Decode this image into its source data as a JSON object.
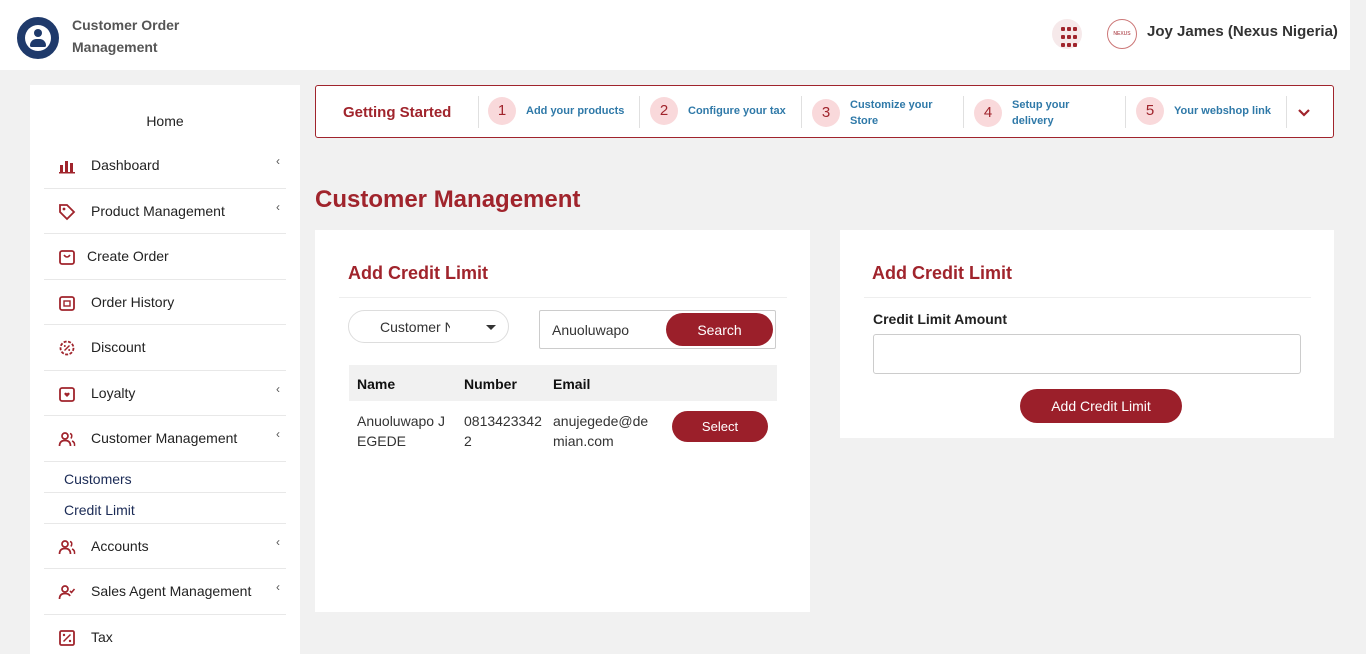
{
  "header": {
    "app_name": "Customer Order Management",
    "user_name": "Joy James (Nexus Nigeria)",
    "avatar_text": "NEXUS"
  },
  "sidebar": {
    "home": "Home",
    "items": [
      {
        "label": "Dashboard",
        "icon": "bar-chart-icon",
        "has_chevron": true
      },
      {
        "label": "Product Management",
        "icon": "tag-icon",
        "has_chevron": true
      },
      {
        "label": "Create Order",
        "icon": "shopping-bag-icon",
        "has_chevron": false
      },
      {
        "label": "Order History",
        "icon": "order-history-icon",
        "has_chevron": false
      },
      {
        "label": "Discount",
        "icon": "discount-badge-icon",
        "has_chevron": false
      },
      {
        "label": "Loyalty",
        "icon": "loyalty-bag-icon",
        "has_chevron": true
      },
      {
        "label": "Customer Management",
        "icon": "users-icon",
        "has_chevron": true
      },
      {
        "label": "Accounts",
        "icon": "users-icon",
        "has_chevron": true
      },
      {
        "label": "Sales Agent Management",
        "icon": "user-check-icon",
        "has_chevron": true
      },
      {
        "label": "Tax",
        "icon": "percent-icon",
        "has_chevron": false
      }
    ],
    "customer_sub_items": [
      "Customers",
      "Credit Limit"
    ]
  },
  "getting_started": {
    "title": "Getting Started",
    "steps": [
      {
        "num": "1",
        "label": "Add your products"
      },
      {
        "num": "2",
        "label": "Configure your tax"
      },
      {
        "num": "3",
        "label": "Customize your Store"
      },
      {
        "num": "4",
        "label": "Setup your delivery"
      },
      {
        "num": "5",
        "label": "Your webshop link"
      }
    ]
  },
  "page": {
    "title": "Customer Management"
  },
  "left_card": {
    "title": "Add Credit Limit",
    "select_value": "Customer Name",
    "search_value": "Anuoluwapo",
    "search_button": "Search",
    "columns": [
      "Name",
      "Number",
      "Email"
    ],
    "rows": [
      {
        "name": "Anuoluwapo JEGEDE",
        "number": "08134233422",
        "email": "anujegede@demian.com",
        "action": "Select"
      }
    ]
  },
  "right_card": {
    "title": "Add Credit Limit",
    "field_label": "Credit Limit Amount",
    "field_value": "",
    "button": "Add Credit Limit"
  },
  "colors": {
    "brand": "#9b1f2a",
    "step_label": "#2f79a8",
    "background": "#f1f1f1"
  }
}
